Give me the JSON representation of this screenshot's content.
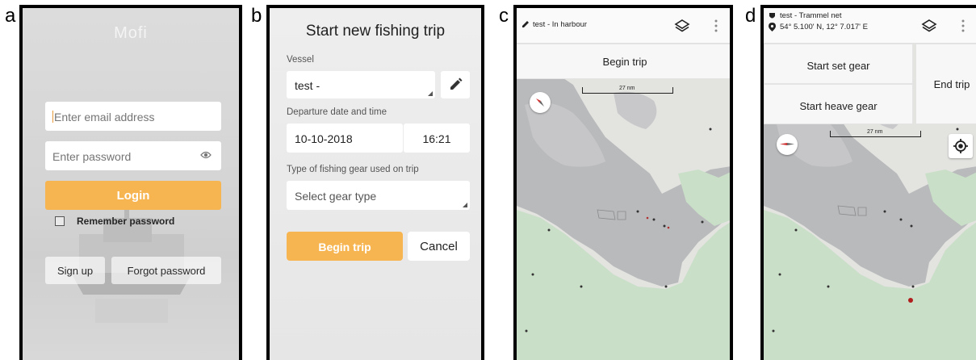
{
  "labels": {
    "a": "a",
    "b": "b",
    "c": "c",
    "d": "d"
  },
  "login": {
    "logo": "Mofi",
    "email_placeholder": "Enter email address",
    "password_placeholder": "Enter password",
    "login_label": "Login",
    "remember_label": "Remember password",
    "signup_label": "Sign up",
    "forgot_label": "Forgot password",
    "accent_color": "#f7b552"
  },
  "trip_form": {
    "title": "Start new fishing trip",
    "vessel_label": "Vessel",
    "vessel_value": "test -",
    "departure_label": "Departure date and time",
    "date_value": "10-10-2018",
    "time_value": "16:21",
    "gear_label": "Type of fishing gear used on trip",
    "gear_placeholder": "Select gear type",
    "begin_label": "Begin trip",
    "cancel_label": "Cancel"
  },
  "map_harbour": {
    "status": "test - In harbour",
    "status_icon": "pencil-icon",
    "begin_label": "Begin trip",
    "scale_label": "27 nm",
    "layers_icon": "layers-icon",
    "menu_icon": "more-vert-icon"
  },
  "map_trip": {
    "vessel_line": "test - Trammel net",
    "position_line": "54° 5.100' N, 12° 7.017' E",
    "start_set_label": "Start set gear",
    "start_heave_label": "Start heave gear",
    "end_trip_label": "End trip",
    "scale_label": "27 nm",
    "locate_icon": "my-location-icon"
  }
}
